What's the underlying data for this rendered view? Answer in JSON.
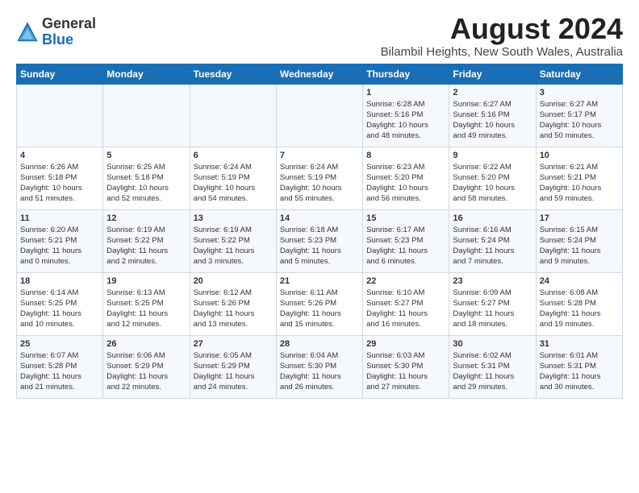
{
  "header": {
    "logo_line1": "General",
    "logo_line2": "Blue",
    "title": "August 2024",
    "subtitle": "Bilambil Heights, New South Wales, Australia"
  },
  "columns": [
    "Sunday",
    "Monday",
    "Tuesday",
    "Wednesday",
    "Thursday",
    "Friday",
    "Saturday"
  ],
  "weeks": [
    [
      {
        "date": "",
        "info": ""
      },
      {
        "date": "",
        "info": ""
      },
      {
        "date": "",
        "info": ""
      },
      {
        "date": "",
        "info": ""
      },
      {
        "date": "1",
        "info": "Sunrise: 6:28 AM\nSunset: 5:16 PM\nDaylight: 10 hours\nand 48 minutes."
      },
      {
        "date": "2",
        "info": "Sunrise: 6:27 AM\nSunset: 5:16 PM\nDaylight: 10 hours\nand 49 minutes."
      },
      {
        "date": "3",
        "info": "Sunrise: 6:27 AM\nSunset: 5:17 PM\nDaylight: 10 hours\nand 50 minutes."
      }
    ],
    [
      {
        "date": "4",
        "info": "Sunrise: 6:26 AM\nSunset: 5:18 PM\nDaylight: 10 hours\nand 51 minutes."
      },
      {
        "date": "5",
        "info": "Sunrise: 6:25 AM\nSunset: 5:18 PM\nDaylight: 10 hours\nand 52 minutes."
      },
      {
        "date": "6",
        "info": "Sunrise: 6:24 AM\nSunset: 5:19 PM\nDaylight: 10 hours\nand 54 minutes."
      },
      {
        "date": "7",
        "info": "Sunrise: 6:24 AM\nSunset: 5:19 PM\nDaylight: 10 hours\nand 55 minutes."
      },
      {
        "date": "8",
        "info": "Sunrise: 6:23 AM\nSunset: 5:20 PM\nDaylight: 10 hours\nand 56 minutes."
      },
      {
        "date": "9",
        "info": "Sunrise: 6:22 AM\nSunset: 5:20 PM\nDaylight: 10 hours\nand 58 minutes."
      },
      {
        "date": "10",
        "info": "Sunrise: 6:21 AM\nSunset: 5:21 PM\nDaylight: 10 hours\nand 59 minutes."
      }
    ],
    [
      {
        "date": "11",
        "info": "Sunrise: 6:20 AM\nSunset: 5:21 PM\nDaylight: 11 hours\nand 0 minutes."
      },
      {
        "date": "12",
        "info": "Sunrise: 6:19 AM\nSunset: 5:22 PM\nDaylight: 11 hours\nand 2 minutes."
      },
      {
        "date": "13",
        "info": "Sunrise: 6:19 AM\nSunset: 5:22 PM\nDaylight: 11 hours\nand 3 minutes."
      },
      {
        "date": "14",
        "info": "Sunrise: 6:18 AM\nSunset: 5:23 PM\nDaylight: 11 hours\nand 5 minutes."
      },
      {
        "date": "15",
        "info": "Sunrise: 6:17 AM\nSunset: 5:23 PM\nDaylight: 11 hours\nand 6 minutes."
      },
      {
        "date": "16",
        "info": "Sunrise: 6:16 AM\nSunset: 5:24 PM\nDaylight: 11 hours\nand 7 minutes."
      },
      {
        "date": "17",
        "info": "Sunrise: 6:15 AM\nSunset: 5:24 PM\nDaylight: 11 hours\nand 9 minutes."
      }
    ],
    [
      {
        "date": "18",
        "info": "Sunrise: 6:14 AM\nSunset: 5:25 PM\nDaylight: 11 hours\nand 10 minutes."
      },
      {
        "date": "19",
        "info": "Sunrise: 6:13 AM\nSunset: 5:25 PM\nDaylight: 11 hours\nand 12 minutes."
      },
      {
        "date": "20",
        "info": "Sunrise: 6:12 AM\nSunset: 5:26 PM\nDaylight: 11 hours\nand 13 minutes."
      },
      {
        "date": "21",
        "info": "Sunrise: 6:11 AM\nSunset: 5:26 PM\nDaylight: 11 hours\nand 15 minutes."
      },
      {
        "date": "22",
        "info": "Sunrise: 6:10 AM\nSunset: 5:27 PM\nDaylight: 11 hours\nand 16 minutes."
      },
      {
        "date": "23",
        "info": "Sunrise: 6:09 AM\nSunset: 5:27 PM\nDaylight: 11 hours\nand 18 minutes."
      },
      {
        "date": "24",
        "info": "Sunrise: 6:08 AM\nSunset: 5:28 PM\nDaylight: 11 hours\nand 19 minutes."
      }
    ],
    [
      {
        "date": "25",
        "info": "Sunrise: 6:07 AM\nSunset: 5:28 PM\nDaylight: 11 hours\nand 21 minutes."
      },
      {
        "date": "26",
        "info": "Sunrise: 6:06 AM\nSunset: 5:29 PM\nDaylight: 11 hours\nand 22 minutes."
      },
      {
        "date": "27",
        "info": "Sunrise: 6:05 AM\nSunset: 5:29 PM\nDaylight: 11 hours\nand 24 minutes."
      },
      {
        "date": "28",
        "info": "Sunrise: 6:04 AM\nSunset: 5:30 PM\nDaylight: 11 hours\nand 26 minutes."
      },
      {
        "date": "29",
        "info": "Sunrise: 6:03 AM\nSunset: 5:30 PM\nDaylight: 11 hours\nand 27 minutes."
      },
      {
        "date": "30",
        "info": "Sunrise: 6:02 AM\nSunset: 5:31 PM\nDaylight: 11 hours\nand 29 minutes."
      },
      {
        "date": "31",
        "info": "Sunrise: 6:01 AM\nSunset: 5:31 PM\nDaylight: 11 hours\nand 30 minutes."
      }
    ]
  ]
}
